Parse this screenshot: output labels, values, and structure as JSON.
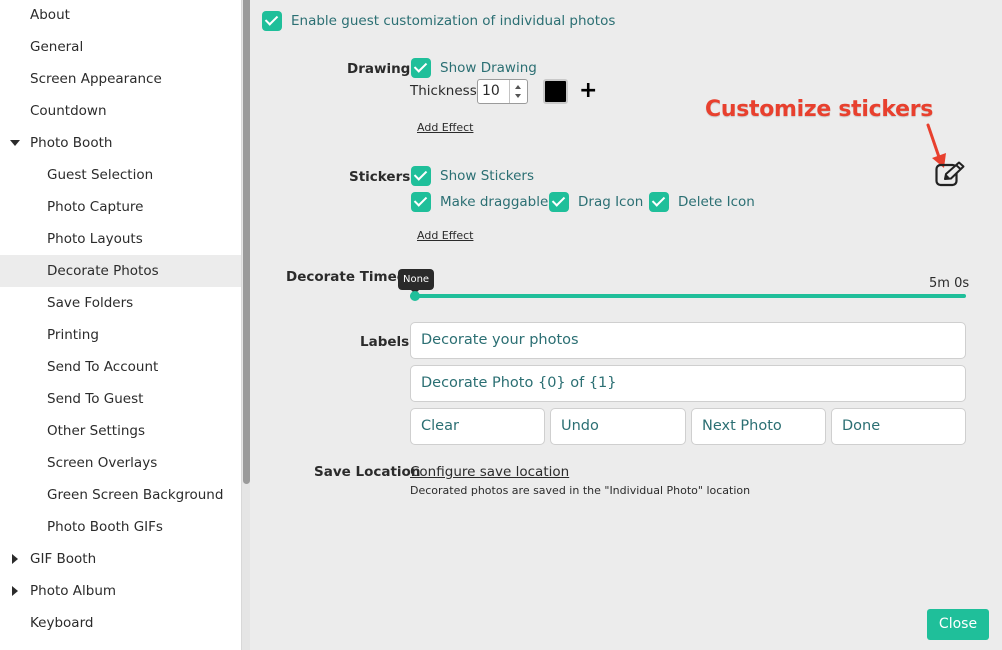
{
  "sidebar": {
    "items": [
      {
        "label": "About"
      },
      {
        "label": "General"
      },
      {
        "label": "Screen Appearance"
      },
      {
        "label": "Countdown"
      },
      {
        "label": "Photo Booth"
      },
      {
        "label": "Guest Selection"
      },
      {
        "label": "Photo Capture"
      },
      {
        "label": "Photo Layouts"
      },
      {
        "label": "Decorate Photos"
      },
      {
        "label": "Save Folders"
      },
      {
        "label": "Printing"
      },
      {
        "label": "Send To Account"
      },
      {
        "label": "Send To Guest"
      },
      {
        "label": "Other Settings"
      },
      {
        "label": "Screen Overlays"
      },
      {
        "label": "Green Screen Background"
      },
      {
        "label": "Photo Booth GIFs"
      },
      {
        "label": "GIF Booth"
      },
      {
        "label": "Photo Album"
      },
      {
        "label": "Keyboard"
      }
    ],
    "active": "Decorate Photos"
  },
  "main": {
    "enable_customization": {
      "label": "Enable guest customization of individual photos",
      "checked": true
    },
    "drawing": {
      "section_label": "Drawing",
      "show_drawing": {
        "label": "Show Drawing",
        "checked": true
      },
      "thickness_label": "Thickness",
      "thickness_value": "10",
      "color": "#000000",
      "add_effect": "Add Effect"
    },
    "stickers": {
      "section_label": "Stickers",
      "show_stickers": {
        "label": "Show Stickers",
        "checked": true
      },
      "make_draggable": {
        "label": "Make draggable",
        "checked": true
      },
      "drag_icon": {
        "label": "Drag Icon",
        "checked": true
      },
      "delete_icon": {
        "label": "Delete Icon",
        "checked": true
      },
      "add_effect": "Add Effect"
    },
    "callout": "Customize stickers",
    "decorate_timeout": {
      "label": "Decorate Timeout",
      "tooltip": "None",
      "max_label": "5m 0s"
    },
    "labels": {
      "section_label": "Labels",
      "title": "Decorate your photos",
      "subtitle": "Decorate Photo {0} of {1}",
      "buttons": [
        "Clear",
        "Undo",
        "Next Photo",
        "Done"
      ]
    },
    "save_location": {
      "section_label": "Save Location",
      "link": "Configure save location",
      "note": "Decorated photos are saved in the \"Individual Photo\" location"
    },
    "close_label": "Close"
  },
  "colors": {
    "accent": "#1fbf9a",
    "label_text": "#2b6f73",
    "callout": "#e8402e"
  }
}
